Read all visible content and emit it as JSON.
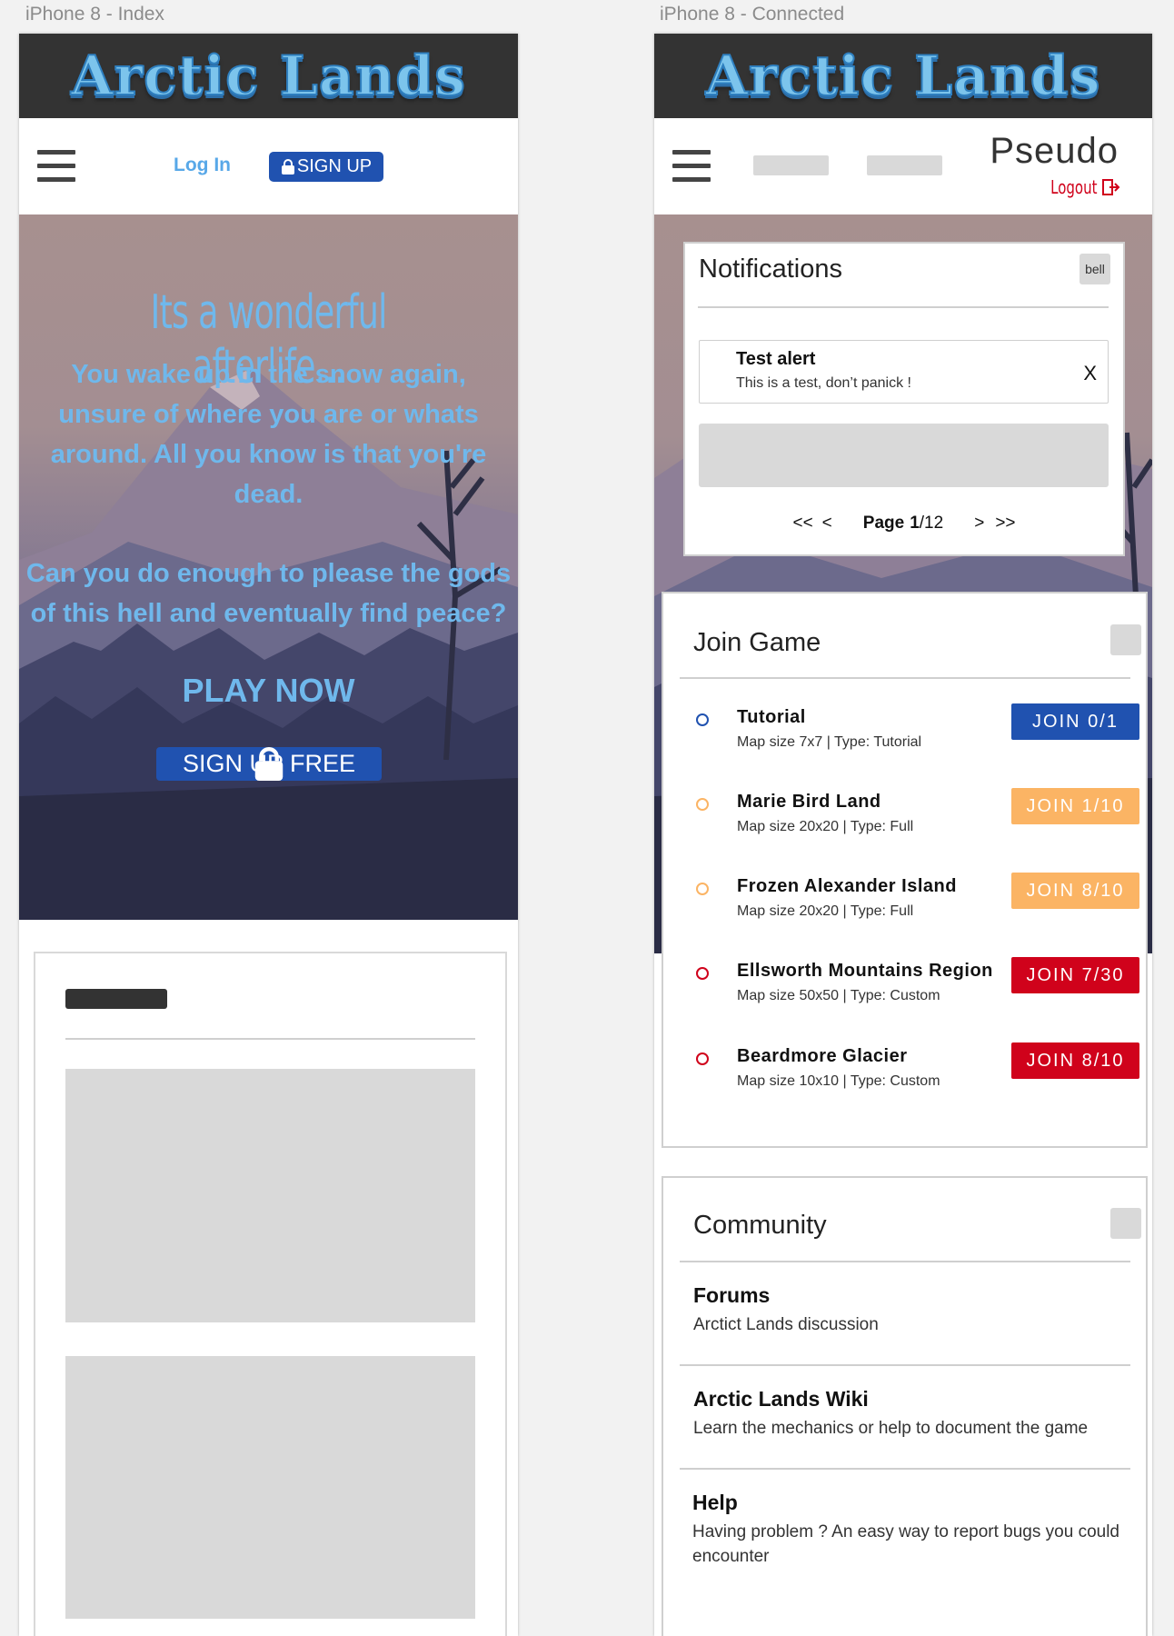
{
  "artboards": {
    "left_label": "iPhone 8 - Index",
    "right_label": "iPhone 8 - Connected"
  },
  "brand": {
    "logo_text": "Arctic Lands",
    "logo_color": "#7cc4ec"
  },
  "index": {
    "nav": {
      "login_label": "Log In",
      "signup_label": "SIGN UP"
    },
    "hero": {
      "tagline": "Its a wonderful afterlife...",
      "paragraph1": "You wake up in the snow again, unsure of where you are or whats around. All you know is that you're dead.",
      "paragraph2": "Can you do enough to please the gods of this hell and eventually find peace?",
      "play_label": "PLAY NOW",
      "signup_free_label": "SIGN UP FREE"
    }
  },
  "connected": {
    "nav": {
      "username": "Pseudo",
      "logout_label": "Logout"
    },
    "notifications": {
      "title": "Notifications",
      "bell_label": "bell",
      "alert_title": "Test alert",
      "alert_text": "This is a test, don’t panick !",
      "alert_close": "X",
      "pager": {
        "first": "<<",
        "prev": "<",
        "page_word": "Page",
        "current": "1",
        "total": "/12",
        "next": ">",
        "last": ">>"
      }
    },
    "join_game": {
      "title": "Join Game",
      "games": [
        {
          "name": "Tutorial",
          "meta": "Map size 7x7 | Type: Tutorial",
          "join_label": "JOIN 0/1",
          "color": "#2052b0"
        },
        {
          "name": "Marie Bird Land",
          "meta": "Map size 20x20 | Type: Full",
          "join_label": "JOIN 1/10",
          "color": "#fbb464"
        },
        {
          "name": "Frozen Alexander Island",
          "meta": "Map size 20x20 | Type: Full",
          "join_label": "JOIN 8/10",
          "color": "#fbb464"
        },
        {
          "name": "Ellsworth Mountains Region",
          "meta": "Map size 50x50 | Type: Custom",
          "join_label": "JOIN 7/30",
          "color": "#d0021b"
        },
        {
          "name": "Beardmore Glacier",
          "meta": "Map size 10x10 | Type: Custom",
          "join_label": "JOIN 8/10",
          "color": "#d0021b"
        }
      ]
    },
    "community": {
      "title": "Community",
      "items": [
        {
          "title": "Forums",
          "desc": "Arctict Lands discussion"
        },
        {
          "title": "Arctic Lands Wiki",
          "desc": "Learn the mechanics or help to document the game"
        },
        {
          "title": "Help",
          "desc": "Having problem ? An easy way to report bugs you could encounter"
        }
      ]
    }
  }
}
